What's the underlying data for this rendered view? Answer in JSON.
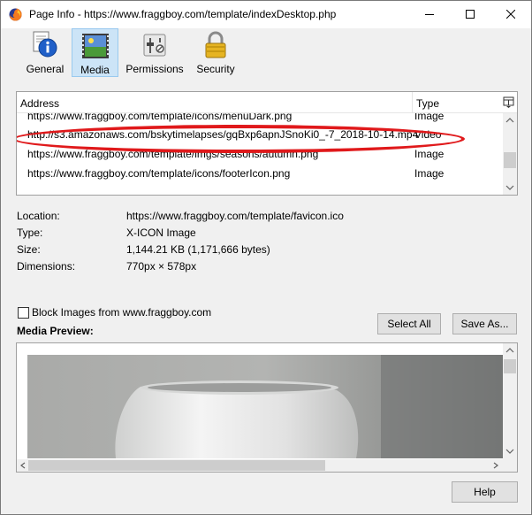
{
  "window": {
    "title": "Page Info - https://www.fraggboy.com/template/indexDesktop.php"
  },
  "tabs": [
    {
      "label": "General",
      "icon": "info-icon",
      "selected": false
    },
    {
      "label": "Media",
      "icon": "media-icon",
      "selected": true
    },
    {
      "label": "Permissions",
      "icon": "permissions-icon",
      "selected": false
    },
    {
      "label": "Security",
      "icon": "lock-icon",
      "selected": false
    }
  ],
  "media_list": {
    "columns": {
      "address": "Address",
      "type": "Type"
    },
    "rows": [
      {
        "address": "https://www.fraggboy.com/template/icons/menuDark.png",
        "type": "Image"
      },
      {
        "address": "http://s3.amazonaws.com/bskytimelapses/gqBxp6apnJSnoKi0_-7_2018-10-14.mp4",
        "type": "Video"
      },
      {
        "address": "https://www.fraggboy.com/template/imgs/seasons/autumn.png",
        "type": "Image"
      },
      {
        "address": "https://www.fraggboy.com/template/icons/footerIcon.png",
        "type": "Image"
      }
    ],
    "highlight_color": "#e0191b"
  },
  "details": {
    "location_label": "Location:",
    "location_value": "https://www.fraggboy.com/template/favicon.ico",
    "type_label": "Type:",
    "type_value": "X-ICON Image",
    "size_label": "Size:",
    "size_value": "1,144.21 KB (1,171,666 bytes)",
    "dimensions_label": "Dimensions:",
    "dimensions_value": "770px × 578px"
  },
  "block_images": {
    "label": "Block Images from www.fraggboy.com",
    "checked": false
  },
  "buttons": {
    "select_all": "Select All",
    "save_as": "Save As...",
    "help": "Help"
  },
  "preview": {
    "title": "Media Preview:"
  }
}
